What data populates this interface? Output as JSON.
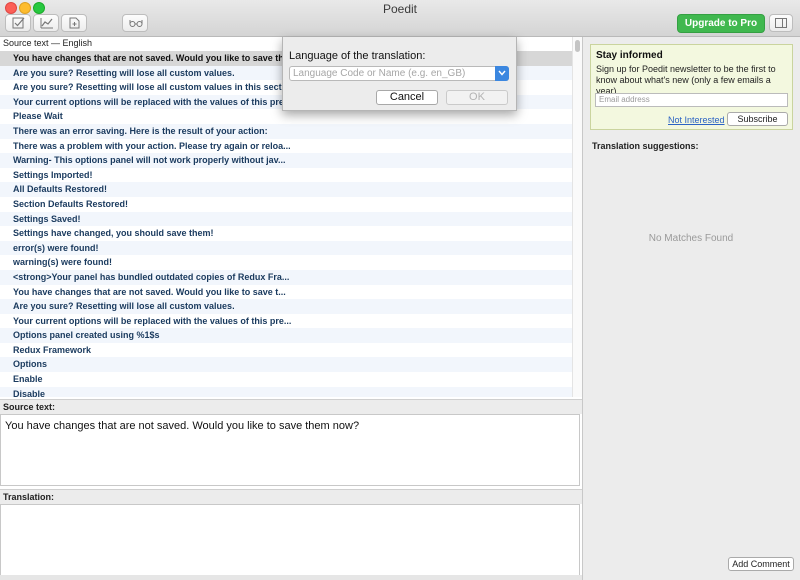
{
  "window": {
    "title": "Poedit"
  },
  "toolbar": {
    "buttons": [
      {
        "icon": "checkmark-edit-icon"
      },
      {
        "icon": "chart-icon"
      },
      {
        "icon": "document-add-icon"
      },
      {
        "icon": "glasses-icon"
      },
      {
        "icon": "sidebar-toggle-icon"
      }
    ],
    "upgrade_label": "Upgrade to Pro",
    "upgrade_color": "#40b84f"
  },
  "list": {
    "header": "Source text — English",
    "rows": [
      "You have changes that are not saved. Would you like to save th...",
      "Are you sure? Resetting will lose all custom values.",
      "Are you sure? Resetting will lose all custom values in this secti...",
      "Your current options will be replaced with the values of this pre...",
      "Please Wait",
      "There was an error saving. Here is the result of your action:",
      "There was a problem with your action. Please try again or reloa...",
      "Warning- This options panel will not work properly without jav...",
      "Settings Imported!",
      "All Defaults Restored!",
      "Section Defaults Restored!",
      "Settings Saved!",
      "Settings have changed, you should save them!",
      "error(s) were found!",
      "warning(s) were found!",
      "<strong>Your panel has bundled outdated copies of Redux Fra...",
      "You have changes that are not saved.  Would you like to save t...",
      "Are you sure?  Resetting will lose all custom values.",
      "Your current options will be replaced with the values of this pre...",
      "Options panel created using %1$s",
      "Redux Framework",
      "Options",
      "Enable",
      "Disable"
    ]
  },
  "editor": {
    "source_label": "Source text:",
    "source_text": "You have changes that are not saved. Would you like to save them now?",
    "translation_label": "Translation:"
  },
  "sidebar": {
    "newsletter": {
      "title": "Stay informed",
      "text": "Sign up for Poedit newsletter to be the first to know about what's new (only a few emails a year).",
      "email_placeholder": "Email address",
      "not_interested": "Not Interested",
      "subscribe": "Subscribe"
    },
    "suggestions_label": "Translation suggestions:",
    "no_matches": "No Matches Found",
    "add_comment": "Add Comment"
  },
  "dialog": {
    "title": "Language of the translation:",
    "placeholder": "Language Code or Name (e.g. en_GB)",
    "cancel": "Cancel",
    "ok": "OK"
  }
}
